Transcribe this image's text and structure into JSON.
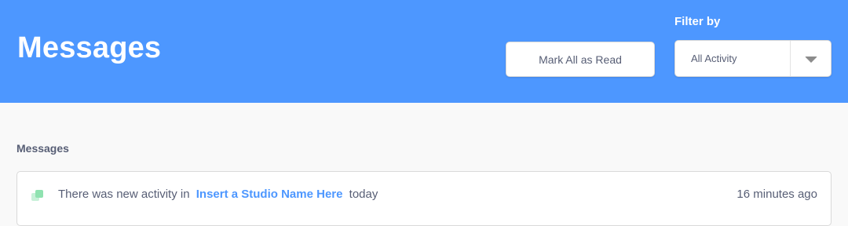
{
  "header": {
    "title": "Messages",
    "mark_all_label": "Mark All as Read",
    "filter_label": "Filter by",
    "filter_selected": "All Activity",
    "background_color": "#4d97ff"
  },
  "section": {
    "title": "Messages"
  },
  "messages": [
    {
      "icon": "studio-icon",
      "text_before": "There was new activity in",
      "link_text": "Insert a Studio Name Here",
      "text_after": "today",
      "timestamp": "16 minutes ago"
    }
  ]
}
